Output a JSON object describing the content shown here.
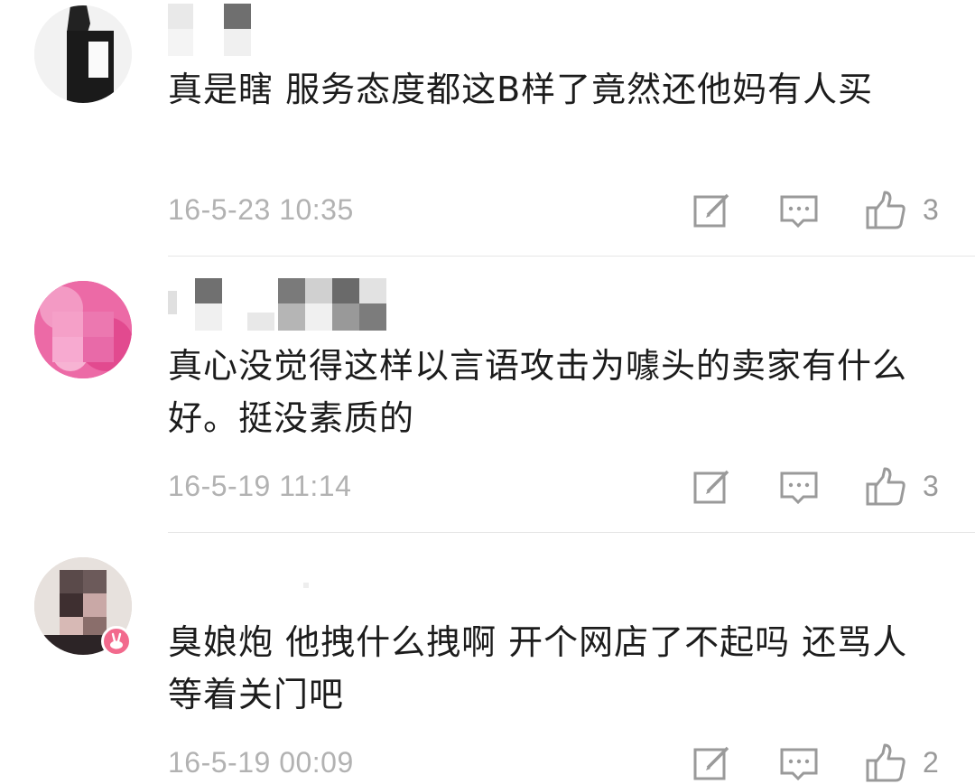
{
  "comments": [
    {
      "text": "真是瞎 服务态度都这B样了竟然还他妈有人买",
      "timestamp": "16-5-23 10:35",
      "likes": "3"
    },
    {
      "text": "真心没觉得这样以言语攻击为噱头的卖家有什么好。挺没素质的",
      "timestamp": "16-5-19 11:14",
      "likes": "3"
    },
    {
      "text": "臭娘炮 他拽什么拽啊 开个网店了不起吗 还骂人 等着关门吧",
      "timestamp": "16-5-19 00:09",
      "likes": "2"
    }
  ],
  "icons": {
    "reply": "compose-icon",
    "comment": "comment-bubble-icon",
    "like": "thumbs-up-icon",
    "badge": "rabbit-badge-icon"
  },
  "colors": {
    "text": "#1c1c1c",
    "timestamp": "#b2b2b2",
    "icon": "#9a9a9a",
    "badge": "#f26a8d"
  }
}
